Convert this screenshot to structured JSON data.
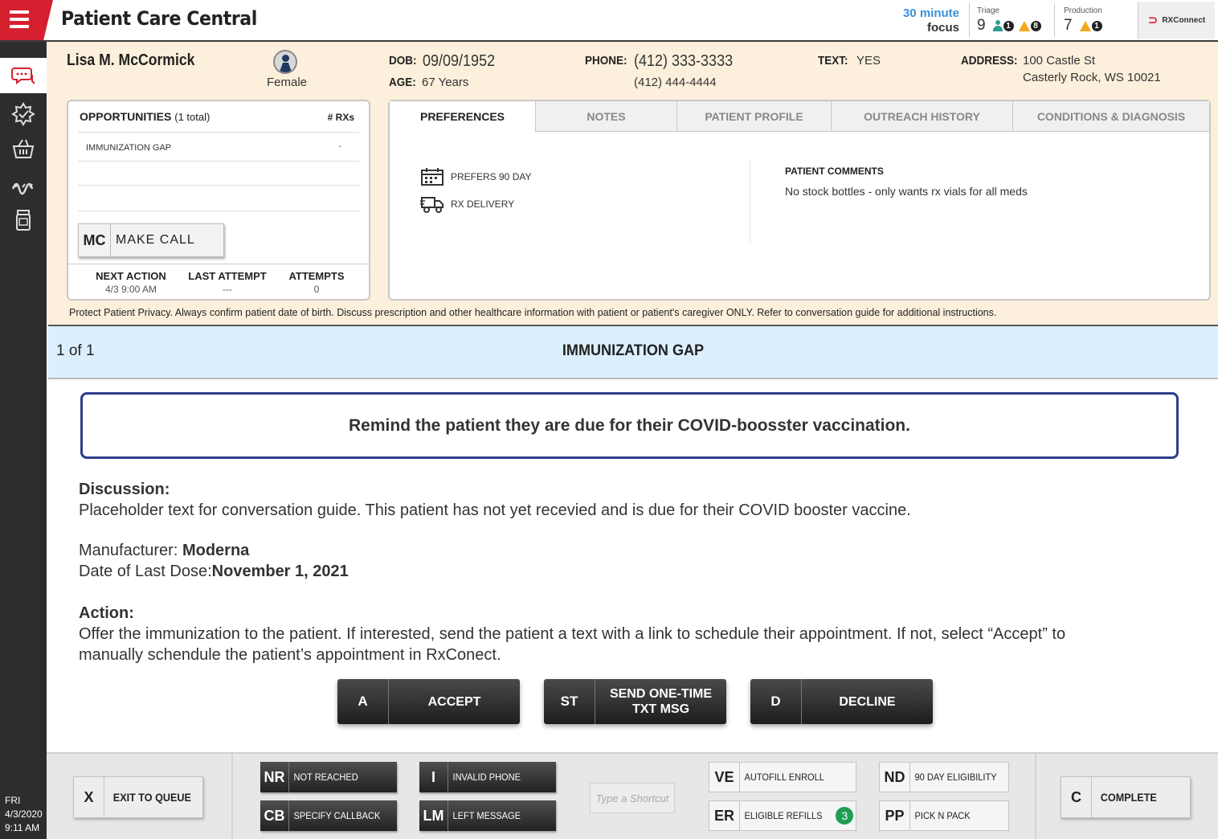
{
  "header": {
    "app_title": "Patient Care Central",
    "focus_line1": "30 minute",
    "focus_line2": "focus",
    "triage": {
      "label": "Triage",
      "value": "9",
      "people_count": "1",
      "warn_count": "8"
    },
    "production": {
      "label": "Production",
      "value": "7",
      "warn_count": "1"
    },
    "rxconnect_label": "RXConnect"
  },
  "rail": {
    "day": "FRI",
    "date": "4/3/2020",
    "time": "9:11 AM"
  },
  "patient": {
    "name": "Lisa M. McCormick",
    "gender": "Female",
    "dob_label": "DOB:",
    "dob": "09/09/1952",
    "age_label": "AGE:",
    "age": "67 Years",
    "phone_label": "PHONE:",
    "phone_primary": "(412) 333-3333",
    "phone_secondary": "(412) 444-4444",
    "text_label": "TEXT:",
    "text_value": "YES",
    "address_label": "ADDRESS:",
    "address_line1": "100 Castle St",
    "address_line2": "Casterly Rock, WS 10021"
  },
  "opportunities": {
    "title": "OPPORTUNITIES",
    "total": "(1 total)",
    "rxs_header": "# RXs",
    "items": [
      {
        "name": "IMMUNIZATION GAP",
        "rxs": "-"
      }
    ],
    "make_call": {
      "key": "MC",
      "label": "MAKE CALL"
    },
    "next_action_label": "NEXT ACTION",
    "next_action_value": "4/3 9:00 AM",
    "last_attempt_label": "LAST ATTEMPT",
    "last_attempt_value": "---",
    "attempts_label": "ATTEMPTS",
    "attempts_value": "0"
  },
  "tabs": [
    {
      "label": "PREFERENCES",
      "active": true
    },
    {
      "label": "NOTES"
    },
    {
      "label": "PATIENT PROFILE"
    },
    {
      "label": "OUTREACH HISTORY"
    },
    {
      "label": "CONDITIONS & DIAGNOSIS"
    }
  ],
  "preferences": {
    "items": [
      "PREFERS 90 DAY",
      "RX DELIVERY"
    ],
    "comments_title": "PATIENT COMMENTS",
    "comments_text": "No stock bottles - only wants rx vials for all meds"
  },
  "privacy_notice": "Protect Patient Privacy.  Always confirm patient date of birth. Discuss prescription and other healthcare information with patient or patient's caregiver ONLY.  Refer to conversation guide for additional instructions.",
  "opportunity": {
    "count": "1 of 1",
    "title": "IMMUNIZATION GAP",
    "reminder": "Remind the patient they are due for their COVID-boosster vaccination.",
    "discussion_label": "Discussion:",
    "discussion_text": "Placeholder text for conversation guide.  This patient has not yet recevied and is due for their COVID booster vaccine.",
    "manufacturer_label": "Manufacturer:",
    "manufacturer": "Moderna",
    "last_dose_label": "Date of Last Dose:",
    "last_dose": "November 1, 2021",
    "action_label": "Action:",
    "action_line1": "Offer the immunization to the patient.  If interested, send the patient a text with a link to schedule their appointment. If not, select “Accept” to",
    "action_line2": "manually schendule the patient’s appointment in RxConect."
  },
  "actions": {
    "accept": {
      "key": "A",
      "label": "ACCEPT"
    },
    "send": {
      "key": "ST",
      "label1": "SEND ONE-TIME",
      "label2": "TXT MSG"
    },
    "decline": {
      "key": "D",
      "label": "DECLINE"
    }
  },
  "toolbar": {
    "exit": {
      "key": "X",
      "label": "EXIT TO QUEUE"
    },
    "not_reached": {
      "key": "NR",
      "label": "NOT REACHED"
    },
    "specify_callback": {
      "key": "CB",
      "label": "SPECIFY CALLBACK"
    },
    "invalid_phone": {
      "key": "I",
      "label": "INVALID PHONE"
    },
    "left_message": {
      "key": "LM",
      "label": "LEFT MESSAGE"
    },
    "shortcut_placeholder": "Type a Shortcut",
    "autofill": {
      "key": "VE",
      "label": "AUTOFILL ENROLL"
    },
    "eligible_refills": {
      "key": "ER",
      "label": "ELIGIBLE REFILLS",
      "badge": "3"
    },
    "day90": {
      "key": "ND",
      "label": "90 DAY ELIGIBILITY"
    },
    "pick_n_pack": {
      "key": "PP",
      "label": "PICK N PACK"
    },
    "complete": {
      "key": "C",
      "label": "COMPLETE"
    }
  },
  "colors": {
    "brand_red": "#d6202f",
    "accent_blue": "#3b8fd9",
    "reminder_border": "#2c3e8a",
    "band_bg": "#dcefff",
    "header_bg": "#fcf0dc"
  },
  "icons": [
    "menu-icon",
    "chat-icon",
    "badge-icon",
    "basket-icon",
    "pills-icon",
    "bottle-icon",
    "calendar-icon",
    "truck-icon"
  ]
}
